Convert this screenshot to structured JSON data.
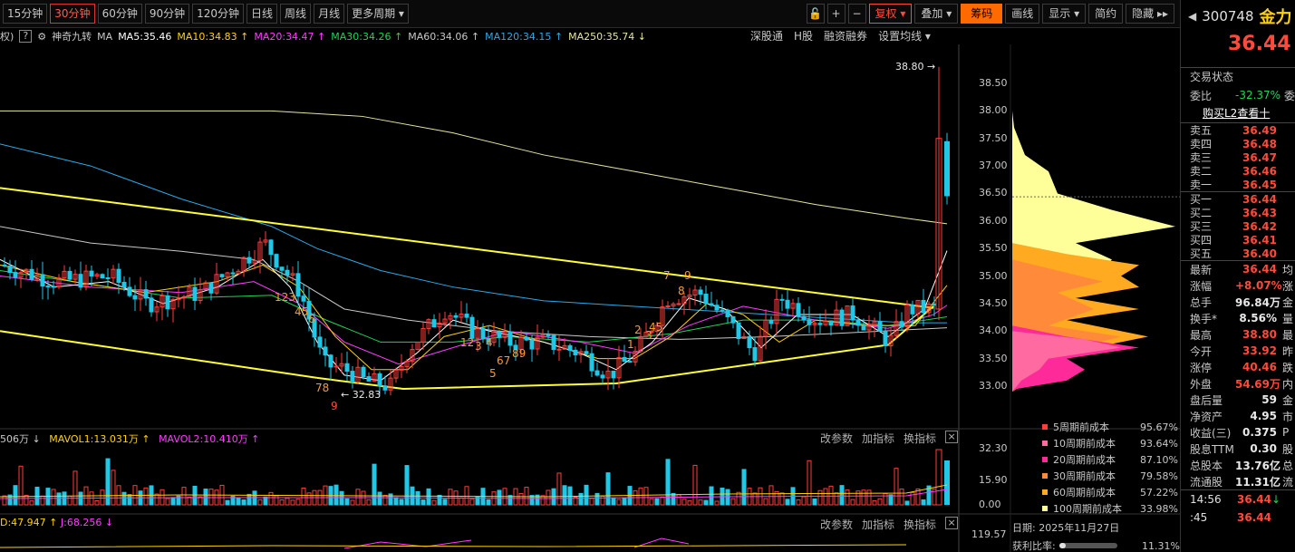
{
  "tabs": [
    {
      "label": "15分钟",
      "active": false
    },
    {
      "label": "30分钟",
      "active": true
    },
    {
      "label": "60分钟",
      "active": false
    },
    {
      "label": "90分钟",
      "active": false
    },
    {
      "label": "120分钟",
      "active": false
    },
    {
      "label": "日线",
      "active": false
    },
    {
      "label": "周线",
      "active": false
    },
    {
      "label": "月线",
      "active": false
    },
    {
      "label": "更多周期 ▾",
      "active": false
    }
  ],
  "toolbar": {
    "lock": "🔓",
    "plus": "+",
    "minus": "−",
    "fuquan": "复权 ▾",
    "diejia": "叠加 ▾",
    "chouma": "筹码",
    "huaxian": "画线",
    "xianshi": "显示 ▾",
    "jianyue": "简约",
    "yincang": "隐藏 ▸▸"
  },
  "ma_bar": {
    "prefix": "权)",
    "help": "?",
    "gear": "⚙",
    "indicator": "神奇九转",
    "ma_label": "MA",
    "ma5": "MA5:35.46",
    "ma10": "MA10:34.83 ↑",
    "ma20": "MA20:34.47 ↑",
    "ma30": "MA30:34.26 ↑",
    "ma60": "MA60:34.06 ↑",
    "ma120": "MA120:34.15 ↑",
    "ma250": "MA250:35.74 ↓"
  },
  "right_tools": {
    "sgt": "深股通",
    "hgu": "H股",
    "rzrq": "融资融券",
    "szjx": "设置均线 ▾"
  },
  "price_axis": [
    "38.50",
    "38.00",
    "37.50",
    "37.00",
    "36.50",
    "36.00",
    "35.50",
    "35.00",
    "34.50",
    "34.00",
    "33.50",
    "33.00"
  ],
  "vol_axis": [
    "32.30",
    "15.90",
    "0.00"
  ],
  "kdj_axis": "119.57",
  "annotations": {
    "high": "38.80 →",
    "low": "← 32.83",
    "nine_turn_top": [
      "7",
      "8",
      "9"
    ],
    "nine_turn_labels": [
      "123",
      "45",
      "6",
      "78",
      "9",
      "12",
      "3",
      "4",
      "67",
      "89",
      "5",
      "1",
      "2",
      "3",
      "45"
    ]
  },
  "vol_bar": {
    "v": "506万 ↓",
    "mavol1": "MAVOL1:13.031万 ↑",
    "mavol2": "MAVOL2:10.410万 ↑"
  },
  "kdj_bar": {
    "d": "D:47.947 ↑",
    "j": "J:68.256 ↓"
  },
  "panel_tools": {
    "gcs": "改参数",
    "jzb": "加指标",
    "hzb": "换指标",
    "close": "×"
  },
  "chip_legend": [
    {
      "label": "5周期前成本",
      "value": "95.67%",
      "color": "#ff3c3c"
    },
    {
      "label": "10周期前成本",
      "value": "93.64%",
      "color": "#ff6aa0"
    },
    {
      "label": "20周期前成本",
      "value": "87.10%",
      "color": "#ff2a9a"
    },
    {
      "label": "30周期前成本",
      "value": "79.58%",
      "color": "#ff8a3a"
    },
    {
      "label": "60周期前成本",
      "value": "57.22%",
      "color": "#ffaa20"
    },
    {
      "label": "100周期前成本",
      "value": "33.98%",
      "color": "#ffff9a"
    }
  ],
  "chip_footer": {
    "date": "日期: 2025年11月27日",
    "profit_label": "获利比率:",
    "profit_value": "11.31%",
    "profit_ratio": 0.1131
  },
  "quote": {
    "arrow": "◀",
    "code": "300748",
    "name": "金力",
    "price": "36.44",
    "status": "交易状态",
    "weibi_label": "委比",
    "weibi_val": "-32.37%",
    "weibi_suffix": "委",
    "l2": "购买L2查看十",
    "asks": [
      {
        "label": "卖五",
        "price": "36.49"
      },
      {
        "label": "卖四",
        "price": "36.48"
      },
      {
        "label": "卖三",
        "price": "36.47"
      },
      {
        "label": "卖二",
        "price": "36.46"
      },
      {
        "label": "卖一",
        "price": "36.45"
      }
    ],
    "bids": [
      {
        "label": "买一",
        "price": "36.44"
      },
      {
        "label": "买二",
        "price": "36.43"
      },
      {
        "label": "买三",
        "price": "36.42"
      },
      {
        "label": "买四",
        "price": "36.41"
      },
      {
        "label": "买五",
        "price": "36.40"
      }
    ],
    "stats": [
      {
        "label": "最新",
        "value": "36.44",
        "suffix": "均",
        "color": "red"
      },
      {
        "label": "涨幅",
        "value": "+8.07%",
        "suffix": "涨",
        "color": "red"
      },
      {
        "label": "总手",
        "value": "96.84万",
        "suffix": "金",
        "color": "white"
      },
      {
        "label": "换手*",
        "value": "8.56%",
        "suffix": "量",
        "color": "white"
      },
      {
        "label": "最高",
        "value": "38.80",
        "suffix": "最",
        "color": "red"
      },
      {
        "label": "今开",
        "value": "33.92",
        "suffix": "昨",
        "color": "red"
      },
      {
        "label": "涨停",
        "value": "40.46",
        "suffix": "跌",
        "color": "red"
      },
      {
        "label": "外盘",
        "value": "54.69万",
        "suffix": "内",
        "color": "red"
      },
      {
        "label": "盘后量",
        "value": "59",
        "suffix": "金",
        "color": "white"
      },
      {
        "label": "净资产",
        "value": "4.95",
        "suffix": "市",
        "color": "white"
      },
      {
        "label": "收益(三)",
        "value": "0.375",
        "suffix": "P",
        "color": "white"
      },
      {
        "label": "股息TTM",
        "value": "0.30",
        "suffix": "股",
        "color": "white"
      },
      {
        "label": "总股本",
        "value": "13.76亿",
        "suffix": "总",
        "color": "white"
      },
      {
        "label": "流通股",
        "value": "11.31亿",
        "suffix": "流",
        "color": "white"
      }
    ],
    "ticks": [
      {
        "time": "14:56",
        "price": "36.44",
        "dir": "↓"
      },
      {
        "time": ":45",
        "price": "36.44",
        "dir": ""
      }
    ]
  },
  "colors": {
    "up": "#ff3c3c",
    "down": "#1ec8e6",
    "ma5": "#ffffff",
    "ma10": "#ffd200",
    "ma20": "#ff3cff",
    "ma30": "#1cd45a",
    "ma60": "#c8c8c8",
    "ma120": "#2aa8e6",
    "ma250": "#e6e6a0",
    "trend": "#ffff32"
  }
}
